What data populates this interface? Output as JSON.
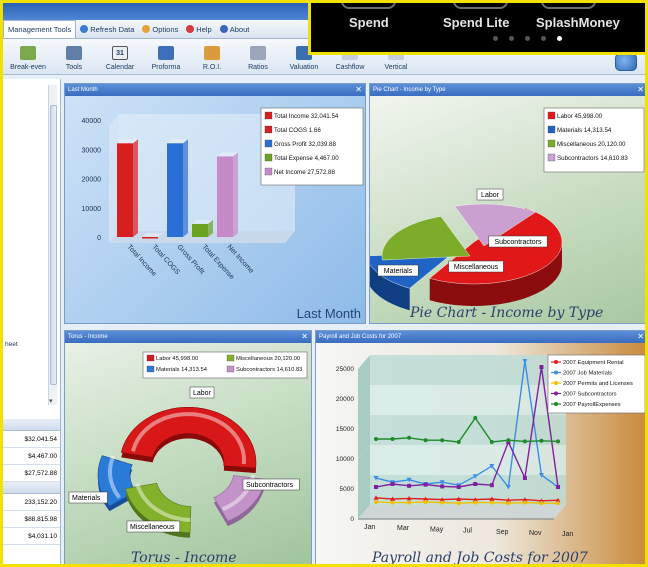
{
  "ribbon": {
    "tabs": [
      {
        "label": "Management Tools",
        "icon": "none",
        "active": true
      },
      {
        "label": "Refresh Data",
        "icon": "refresh-icon"
      },
      {
        "label": "Options",
        "icon": "options-icon"
      },
      {
        "label": "Help",
        "icon": "help-icon"
      },
      {
        "label": "About",
        "icon": "info-icon"
      }
    ],
    "tools": [
      {
        "label": "Break-even",
        "icon": "scale-icon"
      },
      {
        "label": "Tools",
        "icon": "tools-icon"
      },
      {
        "label": "Calendar",
        "icon": "calendar-icon",
        "glyph": "31"
      },
      {
        "label": "Proforma",
        "icon": "proforma-chart-icon"
      },
      {
        "label": "R.O.I.",
        "icon": "roi-icon"
      },
      {
        "label": "Ratios",
        "icon": "ratios-icon"
      },
      {
        "label": "Valuation",
        "icon": "magnifier-icon"
      },
      {
        "label": "Cashflow",
        "icon": "cashflow-icon"
      },
      {
        "label": "Vertical",
        "icon": "vertical-icon"
      }
    ]
  },
  "phone_overlay": {
    "apps": [
      "Spend",
      "Spend Lite",
      "SplashMoney"
    ],
    "page_dots": 5,
    "active_dot": 4
  },
  "left_panel": {
    "sheet_label": "heet",
    "values": [
      "$32,041.54",
      "$4,467.00",
      "$27,572.88",
      "",
      "233,152.20",
      "$88,815.98",
      "$4,031.10"
    ]
  },
  "panes": {
    "last_month": {
      "title": "Last Month",
      "caption": "Last Month"
    },
    "pie": {
      "title": "Pie Chart - Income by Type",
      "caption": "Pie Chart - Income by Type"
    },
    "torus": {
      "title": "Torus - Income",
      "caption": "Torus - Income"
    },
    "payroll": {
      "title": "Payroll and Job Costs for 2007",
      "caption": "Payroll and Job Costs for 2007"
    }
  },
  "chart_data": [
    {
      "type": "bar",
      "title": "Last Month",
      "categories": [
        "Total Income",
        "Total COGS",
        "Gross Profit",
        "Total Expense",
        "Net Income"
      ],
      "values": [
        32041.54,
        1.66,
        32039.88,
        4467.0,
        27572.88
      ],
      "legend": [
        "Total Income 32,041.54",
        "Total COGS 1.66",
        "Gross Profit 32,039.88",
        "Total Expense 4,467.00",
        "Net Income 27,572.88"
      ],
      "colors": [
        "#d81e1e",
        "#d81e1e",
        "#2a6fd3",
        "#6aa322",
        "#c58ac7"
      ],
      "ylim": [
        0,
        40000
      ],
      "yticks": [
        "40000",
        "30000",
        "20000",
        "10000",
        "0"
      ],
      "legend_position": "top-right"
    },
    {
      "type": "pie",
      "title": "Pie Chart - Income by Type",
      "labels": [
        "Labor",
        "Materials",
        "Miscellaneous",
        "Subcontractors"
      ],
      "values": [
        45998.0,
        14313.54,
        20120.0,
        14610.83
      ],
      "legend": [
        "Labor 45,998.00",
        "Materials 14,313.54",
        "Miscellaneous 20,120.00",
        "Subcontractors 14,610.83"
      ],
      "colors": [
        "#e01818",
        "#1f64c4",
        "#7cad2a",
        "#c9a0d0"
      ],
      "legend_position": "top-right"
    },
    {
      "type": "pie",
      "title": "Torus - Income",
      "labels": [
        "Labor",
        "Materials",
        "Miscellaneous",
        "Subcontractors"
      ],
      "values": [
        45998.0,
        14313.54,
        20120.0,
        14610.83
      ],
      "legend": [
        "Labor 45,998.00",
        "Materials 14,313.54",
        "Miscellaneous 20,120.00",
        "Subcontractors 14,610.83"
      ],
      "colors": [
        "#d81818",
        "#2a7ad8",
        "#84b12c",
        "#c392c9"
      ],
      "legend_position": "top"
    },
    {
      "type": "line",
      "title": "Payroll and Job Costs for 2007",
      "x": [
        "Jan",
        "Feb",
        "Mar",
        "Apr",
        "May",
        "Jun",
        "Jul",
        "Aug",
        "Sep",
        "Oct",
        "Nov",
        "Dec"
      ],
      "xticks": [
        "Jan",
        "Mar",
        "May",
        "Jul",
        "Sep",
        "Nov",
        "Jan"
      ],
      "ylim": [
        0,
        25000
      ],
      "yticks": [
        "25000",
        "20000",
        "15000",
        "10000",
        "5000",
        "0"
      ],
      "series": [
        {
          "name": "2007 Equipment Rental",
          "color": "#e02020",
          "marker": "triangle",
          "values": [
            1200,
            1000,
            1100,
            1000,
            900,
            1000,
            900,
            1000,
            800,
            900,
            700,
            800
          ]
        },
        {
          "name": "2007 Job Materials",
          "color": "#3a8ee8",
          "marker": "triangle-down",
          "values": [
            4500,
            3800,
            4200,
            3500,
            3800,
            3300,
            4800,
            6500,
            3000,
            24000,
            5000,
            3000
          ]
        },
        {
          "name": "2007 Permits and Licenses",
          "color": "#f0c000",
          "marker": "circle",
          "values": [
            500,
            400,
            400,
            500,
            400,
            300,
            400,
            400,
            300,
            400,
            300,
            300
          ]
        },
        {
          "name": "2007 Subcontractors",
          "color": "#8020a0",
          "marker": "square",
          "values": [
            3000,
            3500,
            3200,
            3400,
            3100,
            3000,
            3500,
            3300,
            10500,
            4500,
            23000,
            3000
          ]
        },
        {
          "name": "2007 PayrollExpenses",
          "color": "#1e8a2a",
          "marker": "circle",
          "values": [
            11000,
            11000,
            11200,
            10800,
            10800,
            10500,
            14500,
            10500,
            10800,
            10600,
            10700,
            10600
          ]
        }
      ],
      "legend_position": "top-right"
    }
  ],
  "colors": {
    "title_bar": "#3a6cc0",
    "pane_border": "#7c9cc4",
    "highlight_border": "#f2e000"
  }
}
